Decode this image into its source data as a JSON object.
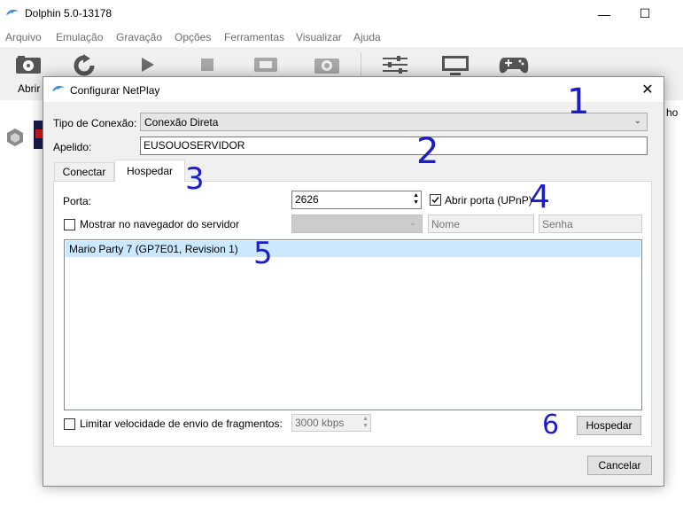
{
  "main_window": {
    "title": "Dolphin 5.0-13178",
    "menu": [
      "Arquivo",
      "Emulação",
      "Gravação",
      "Opções",
      "Ferramentas",
      "Visualizar",
      "Ajuda"
    ],
    "toolbar_open_label": "Abrir",
    "gamelist_partial_text": "ho"
  },
  "dialog": {
    "title": "Configurar NetPlay",
    "connection_type_label": "Tipo de Conexão:",
    "connection_type_value": "Conexão Direta",
    "nickname_label": "Apelido:",
    "nickname_value": "EUSOUOSERVIDOR",
    "tabs": [
      "Conectar",
      "Hospedar"
    ],
    "active_tab": "Hospedar",
    "host": {
      "port_label": "Porta:",
      "port_value": "2626",
      "upnp_label": "Abrir porta (UPnP)",
      "upnp_checked": true,
      "browser_label": "Mostrar no navegador do servidor",
      "browser_checked": false,
      "name_placeholder": "Nome",
      "password_placeholder": "Senha",
      "games": [
        "Mario Party 7 (GP7E01, Revision 1)"
      ],
      "selected_game_index": 0,
      "limit_label": "Limitar velocidade de envio de fragmentos:",
      "limit_checked": false,
      "limit_value": "3000 kbps",
      "host_button": "Hospedar"
    },
    "cancel_button": "Cancelar"
  },
  "annotations": [
    "1",
    "2",
    "3",
    "4",
    "5",
    "6"
  ],
  "colors": {
    "dolphin_logo": "#3a8fd6",
    "selection": "#cce8ff",
    "annotation_ink": "#1c1cc8"
  }
}
